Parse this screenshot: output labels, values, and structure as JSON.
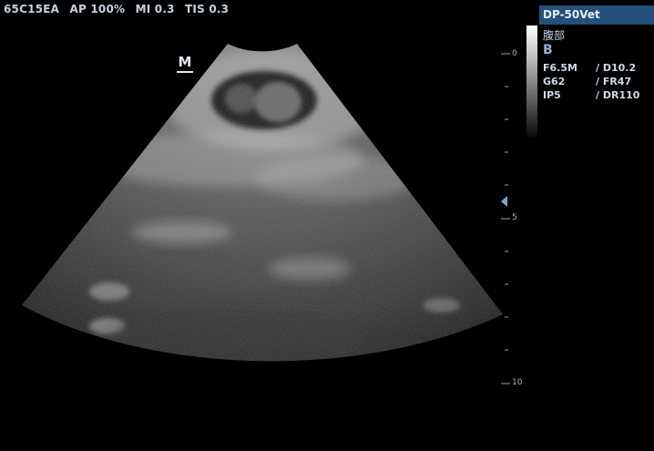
{
  "header": {
    "probe": "65C15EA",
    "acoustic_power": "AP 100%",
    "mi": "MI 0.3",
    "tis": "TIS 0.3"
  },
  "orientation_marker": "M",
  "panel": {
    "title": "DP-50Vet",
    "exam": "腹部",
    "mode": "B",
    "params": [
      {
        "left": "F6.5M",
        "right": "/ D10.2"
      },
      {
        "left": "G62",
        "right": "/ FR47"
      },
      {
        "left": "IP5",
        "right": "/ DR110"
      }
    ]
  },
  "depth_scale": {
    "labels": [
      "0",
      "5",
      "10"
    ]
  },
  "colors": {
    "panel_header": "#24507a",
    "mode_text": "#8fb3d6",
    "focus_marker": "#7fa5c6"
  }
}
